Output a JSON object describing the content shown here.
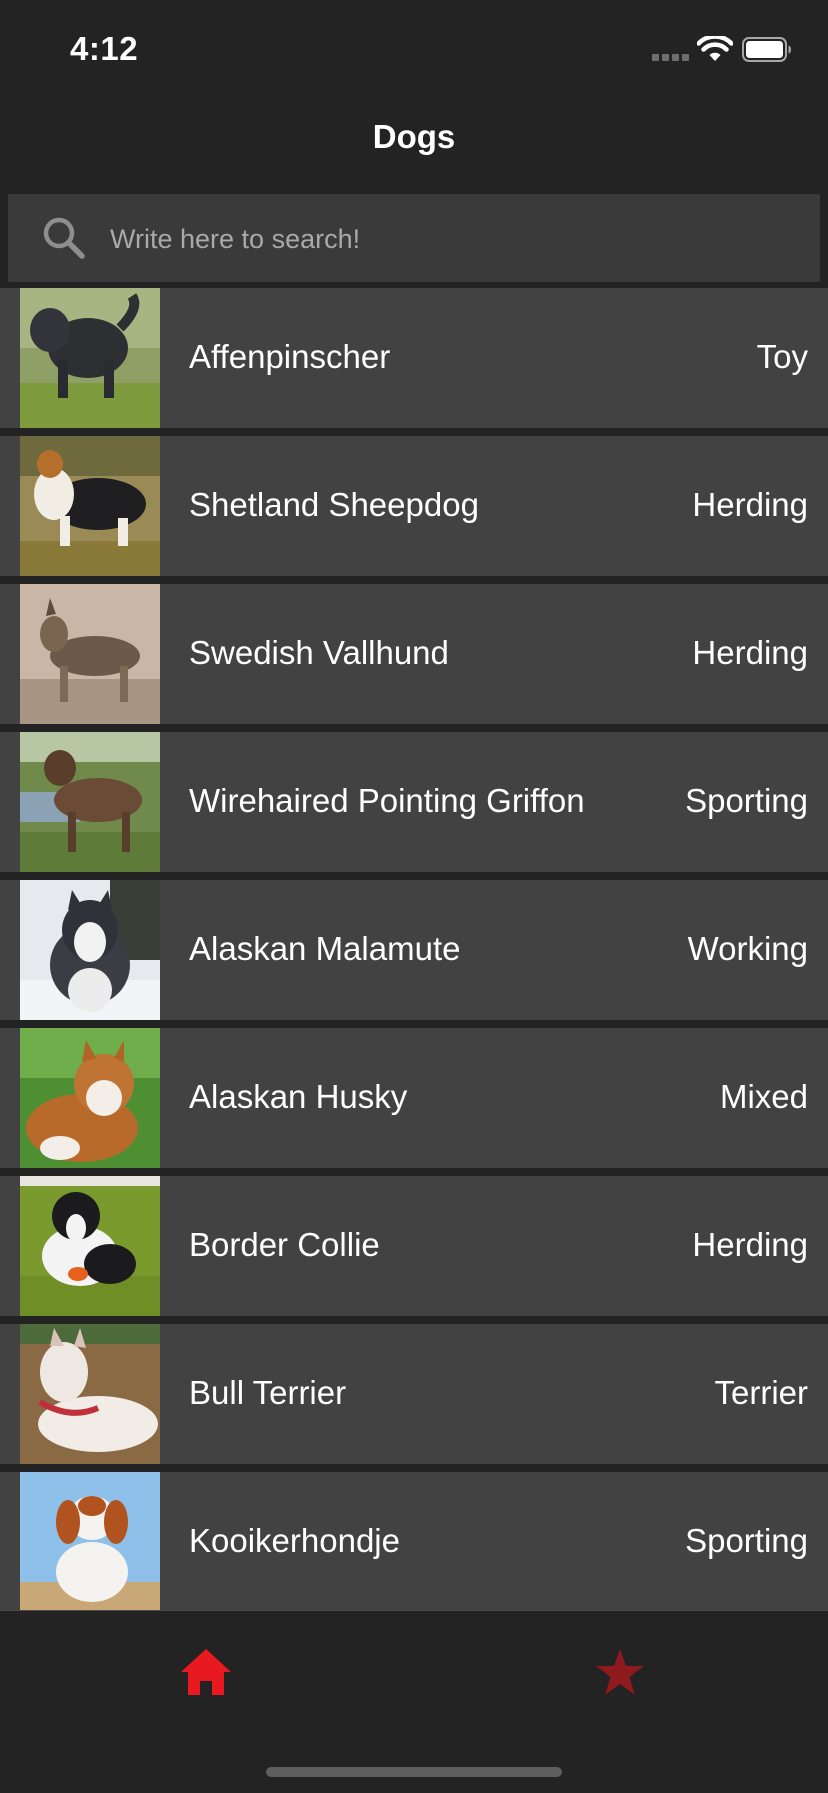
{
  "status_bar": {
    "time": "4:12"
  },
  "nav": {
    "title": "Dogs"
  },
  "search": {
    "placeholder": "Write here to search!",
    "value": ""
  },
  "breeds": [
    {
      "name": "Affenpinscher",
      "group": "Toy",
      "photo": "black-shaggy-dog-on-grass"
    },
    {
      "name": "Shetland Sheepdog",
      "group": "Herding",
      "photo": "sable-white-sheltie"
    },
    {
      "name": "Swedish Vallhund",
      "group": "Herding",
      "photo": "grey-sable-dog-on-sand"
    },
    {
      "name": "Wirehaired Pointing Griffon",
      "group": "Sporting",
      "photo": "brown-roan-dog-by-pond"
    },
    {
      "name": "Alaskan Malamute",
      "group": "Working",
      "photo": "grey-white-malamute-in-snow"
    },
    {
      "name": "Alaskan Husky",
      "group": "Mixed",
      "photo": "red-white-husky-on-grass"
    },
    {
      "name": "Border Collie",
      "group": "Herding",
      "photo": "black-white-collie-on-green-chair"
    },
    {
      "name": "Bull Terrier",
      "group": "Terrier",
      "photo": "white-bull-terrier-lying"
    },
    {
      "name": "Kooikerhondje",
      "group": "Sporting",
      "photo": "orange-white-dog-blue-sky"
    }
  ],
  "tab_bar": {
    "items": [
      {
        "name": "home",
        "icon": "home-icon",
        "active": true
      },
      {
        "name": "favorites",
        "icon": "star-icon",
        "active": false
      }
    ]
  },
  "colors": {
    "background": "#232323",
    "row_background": "#424242",
    "search_background": "#3a3a3a",
    "accent_active": "#e8191f",
    "accent_inactive": "#8e1a1d"
  }
}
